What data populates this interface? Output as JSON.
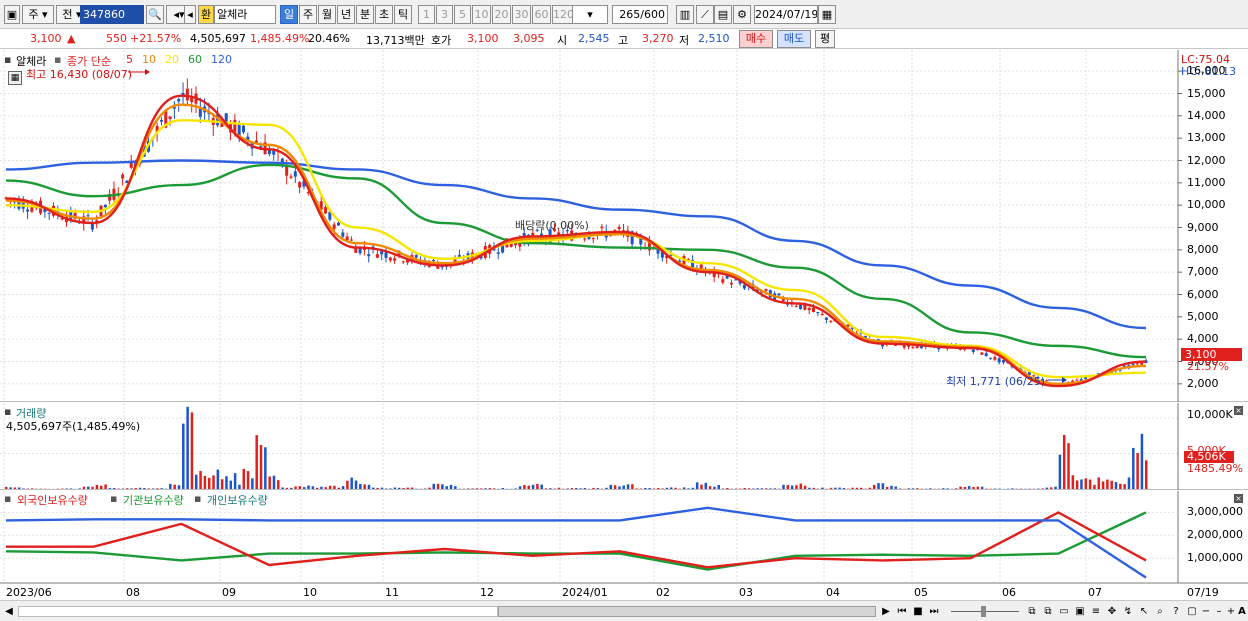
{
  "toolbar": {
    "market": "주",
    "prev": "전",
    "code": "347860",
    "stock_tag": "환",
    "stock_name": "알체라",
    "periods": [
      "일",
      "주",
      "월",
      "년",
      "분",
      "초",
      "틱"
    ],
    "active_period": "일",
    "intervals": [
      "1",
      "3",
      "5",
      "10",
      "20",
      "30",
      "60",
      "120"
    ],
    "count": "265",
    "count_total": "/600",
    "date": "2024/07/19"
  },
  "quote": {
    "price": "3,100",
    "arrow": "▲",
    "change": "550",
    "change_pct": "+21.57%",
    "volume": "4,505,697",
    "volume_pct": "1,485.49%",
    "turnover": "20.46%",
    "amount": "13,713백만",
    "hoga_label": "호가",
    "hoga_ask": "3,100",
    "hoga_bid": "3,095",
    "open_label": "시",
    "open": "2,545",
    "high_label": "고",
    "high": "3,270",
    "low_label": "저",
    "low": "2,510",
    "buy_label": "매수",
    "sell_label": "매도",
    "avg_label": "평"
  },
  "price_panel": {
    "title": "알체라",
    "ma_label": "종가 단순",
    "ma_periods": [
      "5",
      "10",
      "20",
      "60",
      "120"
    ],
    "ma_colors": [
      "#e0201c",
      "#f08a00",
      "#f5e600",
      "#1b9a36",
      "#2e61e0"
    ],
    "high_annotation": "최고 16,430 (08/07)",
    "low_annotation": "최저 1,771 (06/25)",
    "dividend_annotation": "배당락(0.00%)",
    "lc": "LC:75.04",
    "hc": "HC:-81.13",
    "current_price_tag": "3,100",
    "current_pct_tag": "21.57%",
    "y_ticks": [
      "16,000",
      "15,000",
      "14,000",
      "13,000",
      "12,000",
      "11,000",
      "10,000",
      "9,000",
      "8,000",
      "7,000",
      "6,000",
      "5,000",
      "4,000",
      "3,000",
      "2,000"
    ]
  },
  "volume_panel": {
    "title": "거래량",
    "summary": "4,505,697주(1,485.49%)",
    "y_tick_top": "10,000K",
    "y_tick_mid": "5,000K",
    "current_tag": "4,506K",
    "current_pct": "1485.49%"
  },
  "holdings_panel": {
    "legend": [
      "외국인보유수량",
      "기관보유수량",
      "개인보유수량"
    ],
    "legend_colors": [
      "#1b9a36",
      "#e0201c",
      "#2e61e0"
    ],
    "y_ticks": [
      "3,000,000",
      "2,000,000",
      "1,000,000"
    ]
  },
  "x_axis": {
    "labels": [
      "2023/06",
      "08",
      "09",
      "10",
      "11",
      "12",
      "2024/01",
      "02",
      "03",
      "04",
      "05",
      "06",
      "07"
    ],
    "last_label": "07/19"
  },
  "chart_data": [
    {
      "type": "line",
      "title": "알체라",
      "ylabel": "",
      "xlabel": "",
      "ylim": [
        1500,
        16500
      ],
      "x": [
        "2023/06",
        "07",
        "08",
        "09",
        "10",
        "11",
        "12",
        "2024/01",
        "02",
        "03",
        "04",
        "05",
        "06",
        "07"
      ],
      "series": [
        {
          "name": "5",
          "values": [
            10300,
            9200,
            14900,
            12500,
            8100,
            7300,
            8600,
            8800,
            7000,
            5600,
            3800,
            3600,
            1900,
            3000
          ]
        },
        {
          "name": "10",
          "values": [
            10200,
            9400,
            14500,
            12700,
            8300,
            7400,
            8500,
            8700,
            7100,
            5800,
            3900,
            3650,
            2000,
            2800
          ]
        },
        {
          "name": "20",
          "values": [
            10000,
            9700,
            13800,
            13600,
            9000,
            7600,
            8400,
            8700,
            7400,
            6200,
            4100,
            3700,
            2300,
            2500
          ]
        },
        {
          "name": "60",
          "values": [
            11100,
            10400,
            10900,
            11800,
            11200,
            9200,
            8300,
            8100,
            8000,
            7200,
            5800,
            4300,
            3700,
            3200
          ]
        },
        {
          "name": "120",
          "values": [
            11600,
            11900,
            12000,
            11900,
            11600,
            10900,
            10300,
            9800,
            9500,
            8400,
            7300,
            6400,
            5400,
            4500
          ]
        }
      ]
    },
    {
      "type": "bar",
      "title": "거래량",
      "ylim": [
        0,
        11000
      ],
      "note": "units K shares",
      "categories": [
        "2023/06",
        "07",
        "08",
        "09",
        "10",
        "11",
        "12",
        "2024/01",
        "02",
        "03",
        "04",
        "05",
        "06",
        "07"
      ],
      "values": [
        300,
        600,
        9700,
        1800,
        700,
        500,
        600,
        800,
        500,
        700,
        400,
        300,
        6800,
        4506
      ]
    },
    {
      "type": "line",
      "title": "",
      "ylim": [
        0,
        3500000
      ],
      "x": [
        "2023/06",
        "07",
        "08",
        "09",
        "10",
        "11",
        "12",
        "2024/01",
        "02",
        "03",
        "04",
        "05",
        "06",
        "07"
      ],
      "series": [
        {
          "name": "외국인보유수량",
          "values": [
            1300000,
            1250000,
            900000,
            1200000,
            1200000,
            1250000,
            1200000,
            1200000,
            500000,
            1100000,
            1150000,
            1100000,
            1200000,
            3000000
          ]
        },
        {
          "name": "기관보유수량",
          "values": [
            1500000,
            1500000,
            2500000,
            700000,
            1100000,
            1400000,
            1100000,
            1300000,
            600000,
            1000000,
            900000,
            1000000,
            3000000,
            900000
          ]
        },
        {
          "name": "개인보유수량",
          "values": [
            2650000,
            2700000,
            2700000,
            2650000,
            2650000,
            2650000,
            2650000,
            2650000,
            3200000,
            2650000,
            2650000,
            2650000,
            2650000,
            150000
          ]
        }
      ]
    }
  ]
}
